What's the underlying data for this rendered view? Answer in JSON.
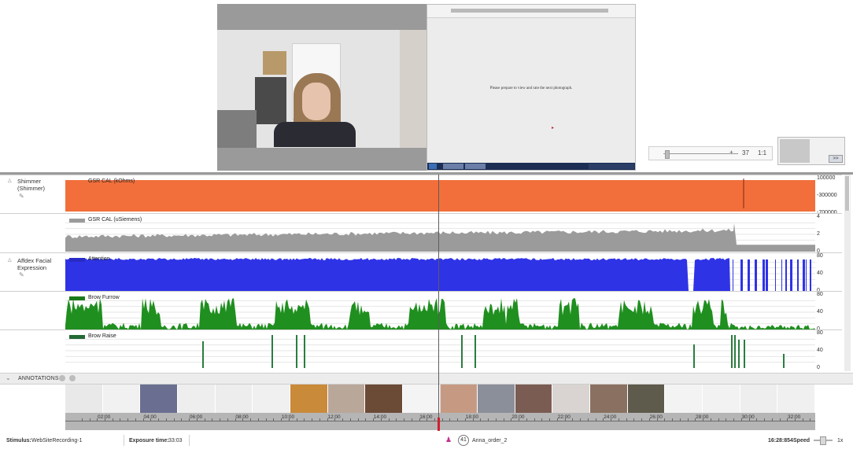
{
  "stimulus_screen": {
    "prompt_text": "Please prepare to view and rate the next photograph."
  },
  "media_control": {
    "frame_value": "37",
    "ratio": "1:1",
    "plus_label": "+"
  },
  "thumb_preview": {
    "button_label": ">>"
  },
  "sensors": [
    {
      "label_line1": "Shimmer",
      "label_line2": "(Shimmer)"
    },
    {
      "label_line1": "Affdex Facial",
      "label_line2": "Expression"
    }
  ],
  "panels": [
    {
      "legend": "GSR CAL (kOhms)",
      "color": "#f26f3b",
      "ticks": [
        "100000",
        "-300000",
        "-700000"
      ]
    },
    {
      "legend": "GSR CAL (uSiemens)",
      "color": "#9b9b9b",
      "ticks": [
        "4",
        "2",
        "0"
      ]
    },
    {
      "legend": "Attention",
      "color": "#2f33e6",
      "ticks": [
        "80",
        "40",
        "0"
      ]
    },
    {
      "legend": "Brow Furrow",
      "color": "#1f8f1f",
      "ticks": [
        "80",
        "40",
        "0"
      ]
    },
    {
      "legend": "Brow Raise",
      "color": "#2a7d3f",
      "ticks": [
        "80",
        "40",
        "0"
      ]
    }
  ],
  "annotations": {
    "label": "ANNOTATIONS"
  },
  "timeline": {
    "ticks": [
      "02:00",
      "04:00",
      "06:00",
      "08:00",
      "10:00",
      "12:00",
      "14:00",
      "16:00",
      "18:00",
      "20:00",
      "22:00",
      "24:00",
      "26:00",
      "28:00",
      "30:00",
      "32:00"
    ]
  },
  "thumbnail_colors": [
    "#e9e9e9",
    "#f1f1f1",
    "#6a6f92",
    "#eeeeee",
    "#ededed",
    "#f0f0f0",
    "#c98a3a",
    "#b9a79a",
    "#6b4a36",
    "#f4f4f4",
    "#c69a82",
    "#8a8f9a",
    "#7b5c52",
    "#d9d4d2",
    "#8a7060",
    "#5e5a4c",
    "#f3f3f3",
    "#f2f2f2",
    "#eeeeee",
    "#f0f0f0"
  ],
  "status": {
    "stimulus_label": "Stimulus:",
    "stimulus_value": "WebSiteRecording-1",
    "exposure_label": "Exposure time:",
    "exposure_value": "33:03",
    "respondent_number": "41",
    "respondent_name": "Anna_order_2",
    "current_time": "16:28:854",
    "speed_label": "Speed",
    "speed_value": "1x"
  }
}
